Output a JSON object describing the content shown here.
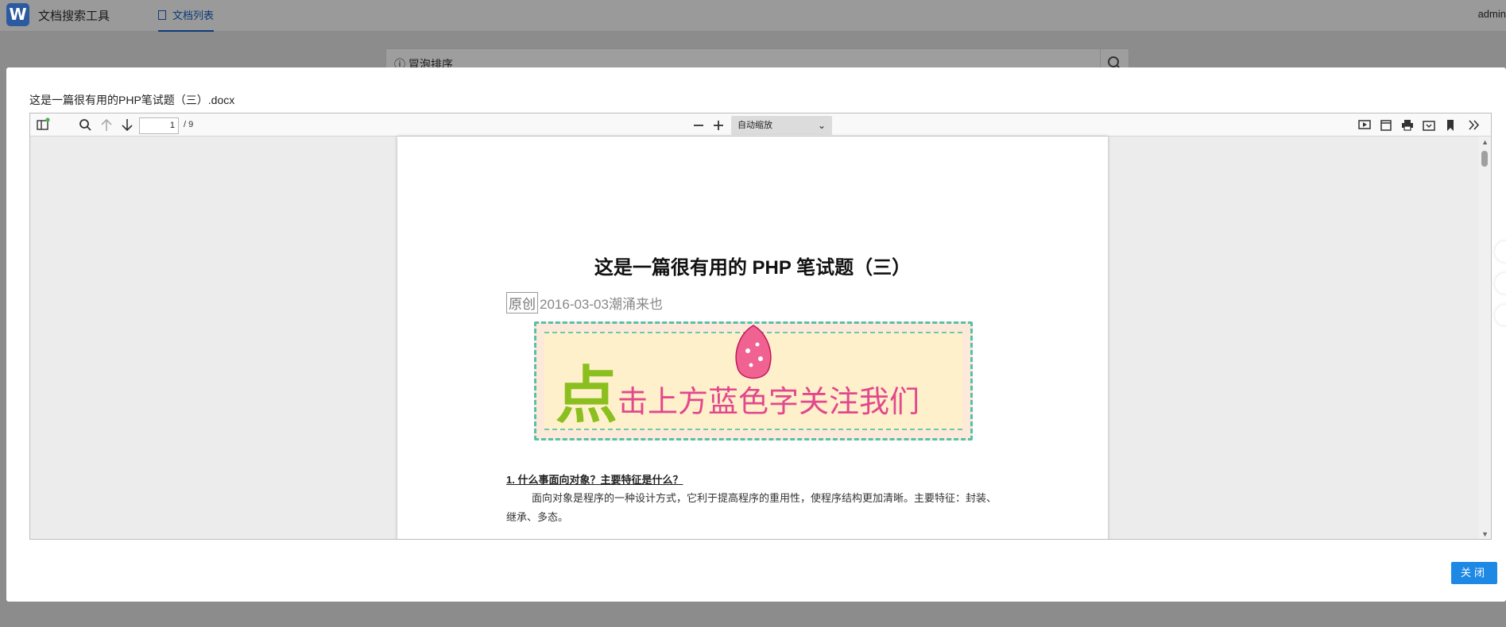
{
  "app": {
    "logo_letter": "W",
    "title": "文档搜索工具",
    "tab_label": "文档列表",
    "user": "admin"
  },
  "background_search": {
    "value": "冒泡排序",
    "info_glyph": "ⓘ"
  },
  "modal": {
    "title": "这是一篇很有用的PHP笔试题（三）.docx",
    "close_label": "关闭"
  },
  "viewer": {
    "current_page": "1",
    "page_count": "/ 9",
    "zoom": "自动缩放",
    "icons": [
      "sidebar-toggle-icon",
      "search-icon",
      "arrow-up-icon",
      "arrow-down-icon",
      "zoom-out-icon",
      "zoom-in-icon",
      "presentation-icon",
      "open-file-icon",
      "print-icon",
      "download-icon",
      "bookmark-icon",
      "more-tools-icon"
    ]
  },
  "document": {
    "title": "这是一篇很有用的 PHP 笔试题（三）",
    "tag": "原创",
    "meta": "2016-03-03潮涌来也",
    "banner_big": "点",
    "banner_text": "击上方蓝色字关注我们",
    "q1_title": "1. 什么事面向对象？主要特征是什么？",
    "q1_body": "面向对象是程序的一种设计方式，它利于提高程序的重用性，使程序结构更加清晰。主要特征：封装、继承、多态。"
  },
  "colors": {
    "accent": "#1e88e5",
    "banner_pink": "#e2488c",
    "banner_green": "#8bbf1f",
    "banner_dash": "#55c1a8"
  }
}
